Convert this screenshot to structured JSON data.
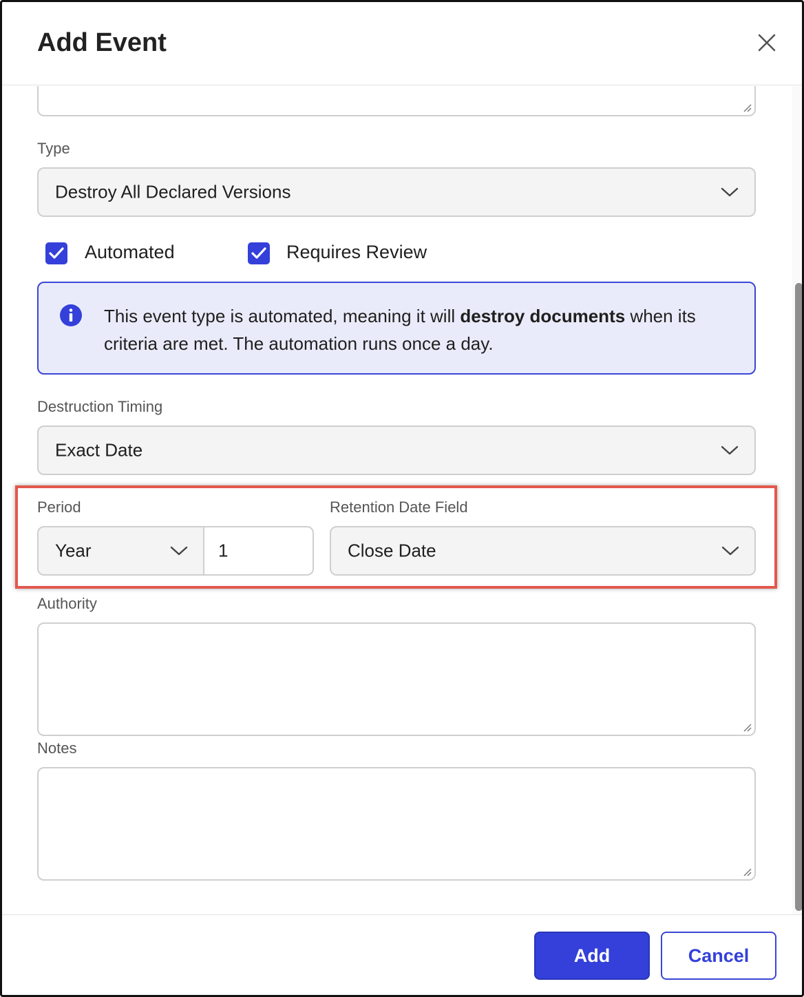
{
  "dialog": {
    "title": "Add Event"
  },
  "form": {
    "type": {
      "label": "Type",
      "value": "Destroy All Declared Versions"
    },
    "automated": {
      "label": "Automated",
      "checked": true
    },
    "requires_review": {
      "label": "Requires Review",
      "checked": true
    },
    "info": {
      "text_before": "This event type is automated, meaning it will ",
      "text_bold": "destroy documents",
      "text_after": " when its criteria are met. The automation runs once a day."
    },
    "destruction_timing": {
      "label": "Destruction Timing",
      "value": "Exact Date"
    },
    "period": {
      "label": "Period",
      "unit": "Year",
      "amount": "1"
    },
    "retention_date_field": {
      "label": "Retention Date Field",
      "value": "Close Date"
    },
    "authority": {
      "label": "Authority",
      "value": ""
    },
    "notes": {
      "label": "Notes",
      "value": ""
    }
  },
  "footer": {
    "add_label": "Add",
    "cancel_label": "Cancel"
  },
  "colors": {
    "accent": "#3440d9",
    "info_bg": "#eaebfa",
    "highlight": "#e3584d"
  }
}
